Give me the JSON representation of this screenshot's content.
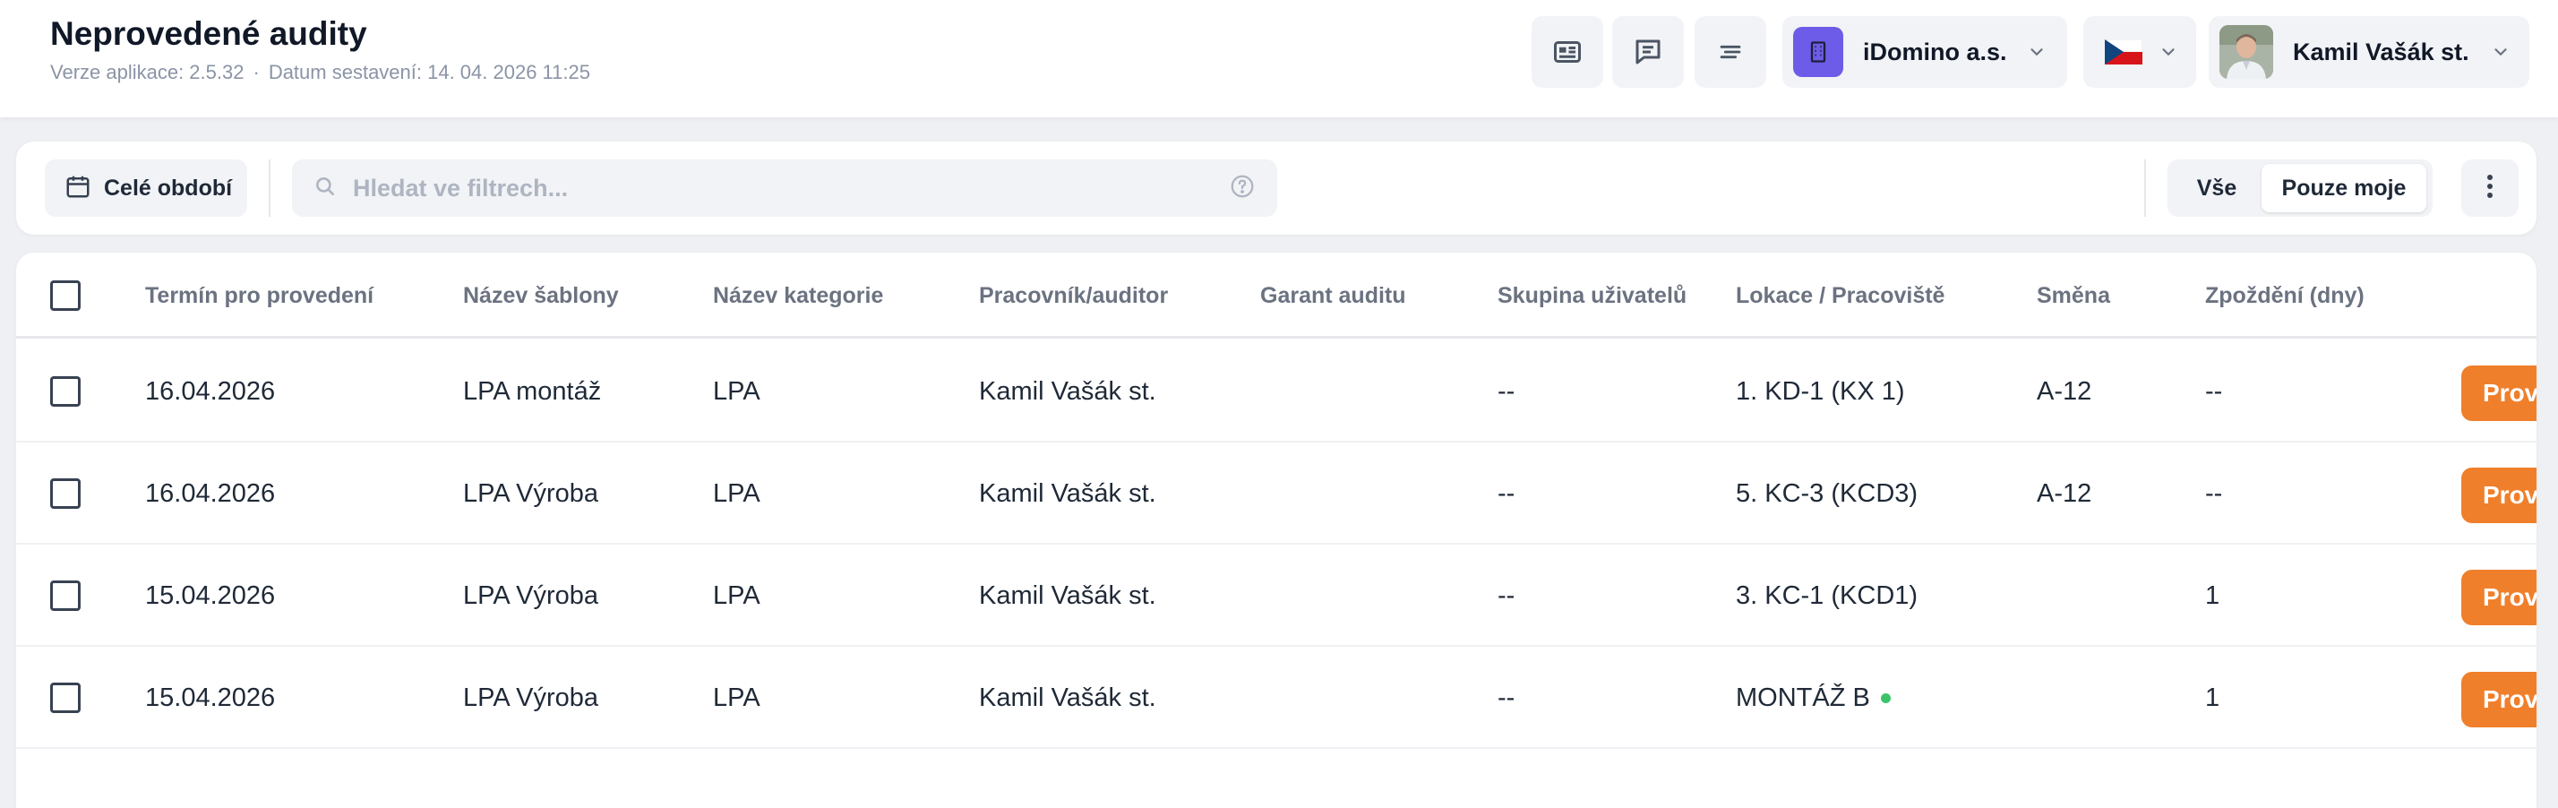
{
  "header": {
    "title": "Neprovedené audity",
    "version": "Verze aplikace: 2.5.32",
    "separator": "·",
    "build_date": "Datum sestavení: 14. 04. 2026 11:25",
    "company": "iDomino a.s.",
    "user": "Kamil Vašák st.",
    "icons": [
      "news-icon",
      "comments-icon",
      "sort-lines-icon",
      "building-icon",
      "czech-flag-icon",
      "chevron-down-icon"
    ]
  },
  "toolbar": {
    "period_label": "Celé období",
    "search_placeholder": "Hledat ve filtrech...",
    "filter_all": "Vše",
    "filter_mine": "Pouze moje",
    "selected_filter": "Pouze moje"
  },
  "table": {
    "columns": [
      "Termín pro provedení",
      "Název šablony",
      "Název kategorie",
      "Pracovník/auditor",
      "Garant auditu",
      "Skupina uživatelů",
      "Lokace / Pracoviště",
      "Směna",
      "Zpoždění (dny)"
    ],
    "rows": [
      {
        "date": "16.04.2026",
        "template": "LPA montáž",
        "category": "LPA",
        "auditor": "Kamil Vašák st.",
        "guarantor": "",
        "group": "--",
        "location": "1. KD-1 (KX 1)",
        "shift": "A-12",
        "delay": "--",
        "action": "Provést"
      },
      {
        "date": "16.04.2026",
        "template": "LPA Výroba",
        "category": "LPA",
        "auditor": "Kamil Vašák st.",
        "guarantor": "",
        "group": "--",
        "location": "5. KC-3 (KCD3)",
        "shift": "A-12",
        "delay": "--",
        "action": "Provést"
      },
      {
        "date": "15.04.2026",
        "template": "LPA Výroba",
        "category": "LPA",
        "auditor": "Kamil Vašák st.",
        "guarantor": "",
        "group": "--",
        "location": "3. KC-1 (KCD1)",
        "shift": "",
        "delay": "1",
        "action": "Provést"
      },
      {
        "date": "15.04.2026",
        "template": "LPA Výroba",
        "category": "LPA",
        "auditor": "Kamil Vašák st.",
        "guarantor": "",
        "group": "--",
        "location": "MONTÁŽ B",
        "shift": "",
        "delay": "1",
        "action": "Provést"
      }
    ]
  },
  "colors": {
    "accent": "#f07f2b",
    "company_logo": "#6d5ce7",
    "status_dot": "#3cc46b"
  }
}
